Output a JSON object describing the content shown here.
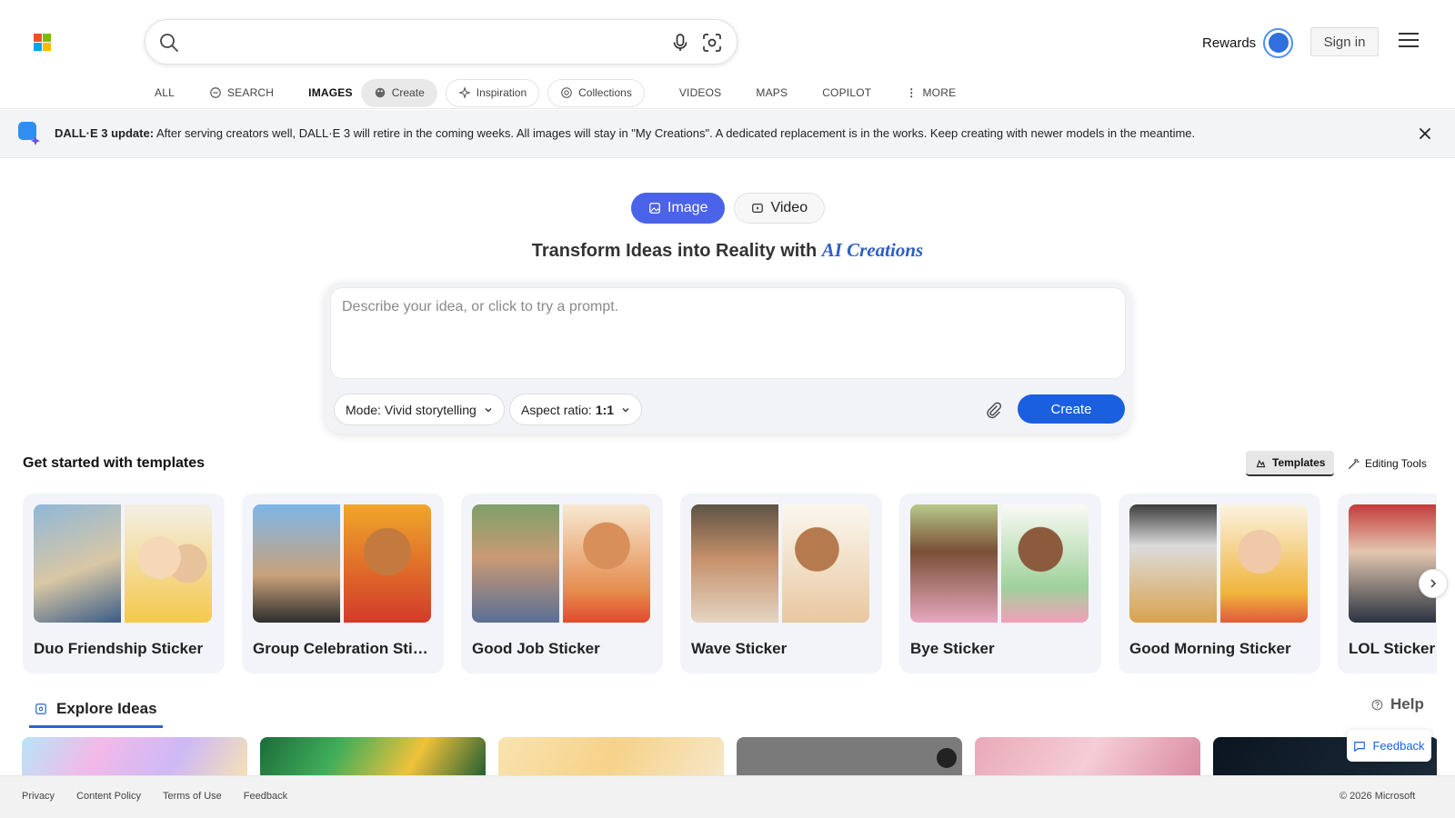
{
  "header": {
    "search_placeholder": "",
    "rewards_label": "Rewards",
    "signin_label": "Sign in"
  },
  "nav": {
    "all": "ALL",
    "search": "SEARCH",
    "images": "IMAGES",
    "create": "Create",
    "inspiration": "Inspiration",
    "collections": "Collections",
    "videos": "VIDEOS",
    "maps": "MAPS",
    "copilot": "COPILOT",
    "more": "MORE"
  },
  "banner": {
    "title": "DALL·E 3 update:",
    "message": " After serving creators well, DALL·E 3 will retire in the coming weeks. All images will stay in \"My Creations\". A dedicated replacement is in the works. Keep creating with newer models in the meantime."
  },
  "create": {
    "tab_image": "Image",
    "tab_video": "Video",
    "headline": "Transform Ideas into Reality with ",
    "headline_accent": "AI Creations",
    "prompt_placeholder": "Describe your idea, or click to try a prompt.",
    "mode_label": "Mode:",
    "mode_value": "Vivid storytelling",
    "aspect_label": "Aspect ratio:",
    "aspect_value": "1:1",
    "create_button": "Create"
  },
  "templates": {
    "title": "Get started with templates",
    "templates_toggle": "Templates",
    "editing_toggle": "Editing Tools",
    "items": [
      {
        "title": "Duo Friendship Sticker"
      },
      {
        "title": "Group Celebration Sticker"
      },
      {
        "title": "Good Job Sticker"
      },
      {
        "title": "Wave Sticker"
      },
      {
        "title": "Bye Sticker"
      },
      {
        "title": "Good Morning Sticker"
      },
      {
        "title": "LOL Sticker"
      }
    ]
  },
  "explore": {
    "tab": "Explore Ideas",
    "help": "Help",
    "feedback": "Feedback"
  },
  "footer": {
    "privacy": "Privacy",
    "content_policy": "Content Policy",
    "terms": "Terms of Use",
    "feedback": "Feedback",
    "copyright": "© 2026 Microsoft"
  },
  "colors": {
    "accent": "#1a5fe0",
    "tab_active": "#4a63e8",
    "headline_accent": "#2f5ec6"
  }
}
